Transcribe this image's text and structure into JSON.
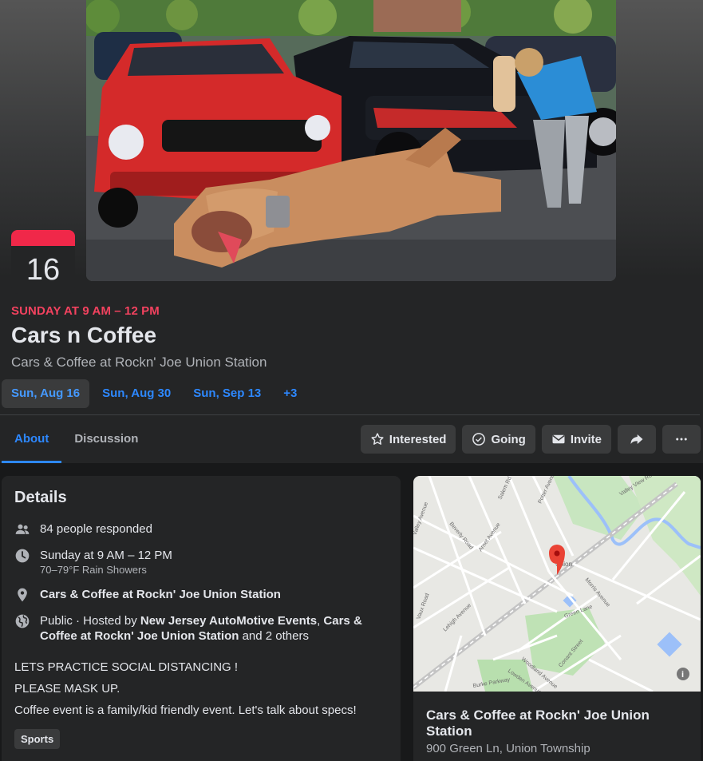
{
  "event": {
    "date_badge_day": "16",
    "when": "SUNDAY AT 9 AM – 12 PM",
    "title": "Cars n Coffee",
    "subtitle": "Cars & Coffee at Rockn' Joe Union Station"
  },
  "dates": [
    {
      "label": "Sun, Aug 16",
      "active": true
    },
    {
      "label": "Sun, Aug 30"
    },
    {
      "label": "Sun, Sep 13"
    },
    {
      "label": "+3"
    }
  ],
  "tabs": [
    {
      "label": "About",
      "active": true
    },
    {
      "label": "Discussion"
    }
  ],
  "actions": {
    "interested": "Interested",
    "going": "Going",
    "invite": "Invite"
  },
  "details": {
    "heading": "Details",
    "responded": "84 people responded",
    "time": "Sunday at 9 AM – 12 PM",
    "weather": "70–79°F Rain Showers",
    "location": "Cars & Coffee at Rockn' Joe Union Station",
    "host_prefix": "Public · Hosted by ",
    "host_1": "New Jersey AutoMotive Events",
    "host_sep": ", ",
    "host_2": "Cars & Coffee at Rockn' Joe Union Station",
    "host_suffix": " and 2 others",
    "desc_1": "LETS PRACTICE SOCIAL DISTANCING !",
    "desc_2": "PLEASE MASK UP.",
    "desc_3": "Coffee event is a family/kid friendly event. Let's talk about specs!",
    "tag": "Sports"
  },
  "map": {
    "location_name": "Cars & Coffee at Rockn' Joe Union Station",
    "address": "900 Green Ln, Union Township",
    "labels": {
      "union": "Union",
      "valley_view": "Valley View Road",
      "morris": "Morris Avenue",
      "green_lane": "Green Lane",
      "lehigh": "Lehigh Avenue",
      "beverly": "Beverly Road",
      "arnet": "Arnet Avenue",
      "salem": "Salem Rd",
      "potter": "Potter Avenue",
      "valley_ave": "Valley Avenue",
      "woodland": "Woodland Avenue",
      "lowden": "Lowden Avenue",
      "conant": "Conant Street",
      "burke": "Burke Parkway",
      "vaux": "Vaux Road"
    }
  },
  "colors": {
    "accent_blue": "#2d88ff",
    "date_red": "#f3425f",
    "card_bg": "#242526",
    "page_bg": "#18191a"
  }
}
